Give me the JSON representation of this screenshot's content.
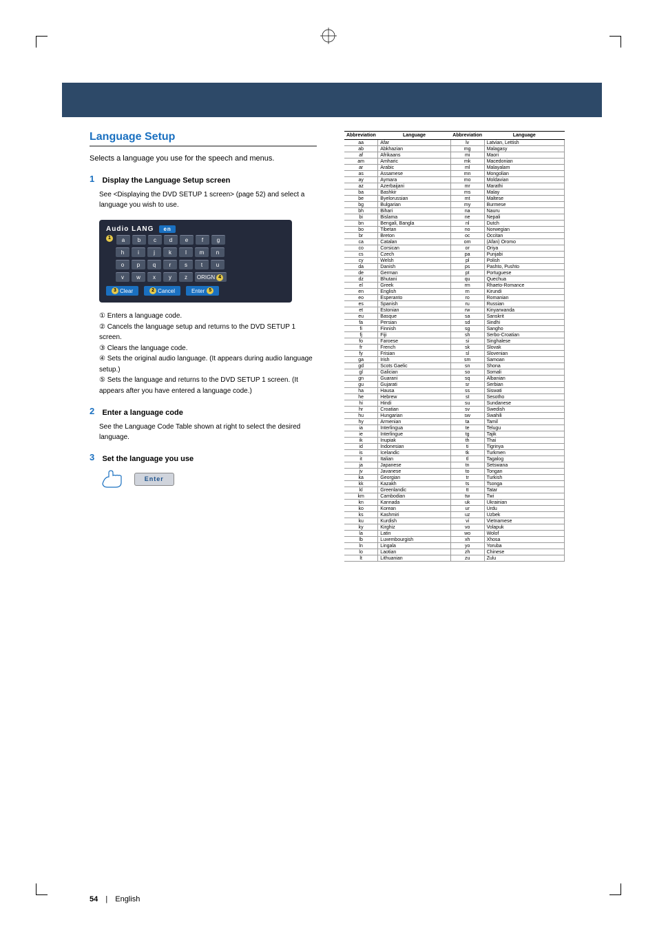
{
  "header": {
    "band": true
  },
  "title": "Language Setup",
  "intro": "Selects a language you use for the speech and menus.",
  "steps": [
    {
      "num": "1",
      "head": "Display the Language Setup screen",
      "body": "See <Displaying the DVD SETUP 1 screen> (page 52) and select a language you wish to use."
    },
    {
      "num": "2",
      "head": "Enter a language code",
      "body": "See the Language Code Table shown at right to select the desired language."
    },
    {
      "num": "3",
      "head": "Set the language you use",
      "body": ""
    }
  ],
  "screen": {
    "title": "Audio  LANG",
    "sub": "en",
    "rows": [
      [
        "a",
        "b",
        "c",
        "d",
        "e",
        "f",
        "g"
      ],
      [
        "h",
        "i",
        "j",
        "k",
        "l",
        "m",
        "n"
      ],
      [
        "o",
        "p",
        "q",
        "r",
        "s",
        "t",
        "u"
      ],
      [
        "v",
        "w",
        "x",
        "y",
        "z",
        "ORIGN"
      ]
    ],
    "badges": {
      "row0": "1",
      "origin": "4"
    },
    "bottom": {
      "clear": "Clear",
      "clear_badge": "3",
      "cancel": "Cancel",
      "cancel_badge": "2",
      "enter": "Enter",
      "enter_badge": "5"
    }
  },
  "listitems": [
    "① Enters a language code.",
    "② Cancels the language setup and returns to the DVD SETUP 1 screen.",
    "③ Clears the language code.",
    "④ Sets the original audio language. (It appears during audio language setup.)",
    "⑤ Sets the language and returns to the DVD SETUP 1 screen. (It appears after you have entered a language code.)"
  ],
  "enter_label": "Enter",
  "table": {
    "headers": [
      "Abbreviation",
      "Language",
      "Abbreviation",
      "Language"
    ],
    "rows": [
      [
        "aa",
        "Afar",
        "lv",
        "Latvian, Lettish"
      ],
      [
        "ab",
        "Abkhazian",
        "mg",
        "Malagasy"
      ],
      [
        "af",
        "Afrikaans",
        "mi",
        "Maori"
      ],
      [
        "am",
        "Amharic",
        "mk",
        "Macedonian"
      ],
      [
        "ar",
        "Arabic",
        "ml",
        "Malayalam"
      ],
      [
        "as",
        "Assamese",
        "mn",
        "Mongolian"
      ],
      [
        "ay",
        "Aymara",
        "mo",
        "Moldavian"
      ],
      [
        "az",
        "Azerbaijani",
        "mr",
        "Marathi"
      ],
      [
        "ba",
        "Bashkir",
        "ms",
        "Malay"
      ],
      [
        "be",
        "Byelorussian",
        "mt",
        "Maltese"
      ],
      [
        "bg",
        "Bulgarian",
        "my",
        "Burmese"
      ],
      [
        "bh",
        "Bihari",
        "na",
        "Nauru"
      ],
      [
        "bi",
        "Bislama",
        "ne",
        "Nepali"
      ],
      [
        "bn",
        "Bengali, Bangla",
        "nl",
        "Dutch"
      ],
      [
        "bo",
        "Tibetan",
        "no",
        "Norwegian"
      ],
      [
        "br",
        "Breton",
        "oc",
        "Occitan"
      ],
      [
        "ca",
        "Catalan",
        "om",
        "(Afan) Oromo"
      ],
      [
        "co",
        "Corsican",
        "or",
        "Oriya"
      ],
      [
        "cs",
        "Czech",
        "pa",
        "Punjabi"
      ],
      [
        "cy",
        "Welsh",
        "pl",
        "Polish"
      ],
      [
        "da",
        "Danish",
        "ps",
        "Pashto, Pushto"
      ],
      [
        "de",
        "German",
        "pt",
        "Portuguese"
      ],
      [
        "dz",
        "Bhutani",
        "qu",
        "Quechua"
      ],
      [
        "el",
        "Greek",
        "rm",
        "Rhaeto-Romance"
      ],
      [
        "en",
        "English",
        "rn",
        "Kirundi"
      ],
      [
        "eo",
        "Esperanto",
        "ro",
        "Romanian"
      ],
      [
        "es",
        "Spanish",
        "ru",
        "Russian"
      ],
      [
        "et",
        "Estonian",
        "rw",
        "Kinyarwanda"
      ],
      [
        "eu",
        "Basque",
        "sa",
        "Sanskrit"
      ],
      [
        "fa",
        "Persian",
        "sd",
        "Sindhi"
      ],
      [
        "fi",
        "Finnish",
        "sg",
        "Sangho"
      ],
      [
        "fj",
        "Fiji",
        "sh",
        "Serbo-Croatian"
      ],
      [
        "fo",
        "Faroese",
        "si",
        "Singhalese"
      ],
      [
        "fr",
        "French",
        "sk",
        "Slovak"
      ],
      [
        "fy",
        "Frisian",
        "sl",
        "Slovenian"
      ],
      [
        "ga",
        "Irish",
        "sm",
        "Samoan"
      ],
      [
        "gd",
        "Scots Gaelic",
        "sn",
        "Shona"
      ],
      [
        "gl",
        "Galician",
        "so",
        "Somali"
      ],
      [
        "gn",
        "Guarani",
        "sq",
        "Albanian"
      ],
      [
        "gu",
        "Gujarati",
        "sr",
        "Serbian"
      ],
      [
        "ha",
        "Hausa",
        "ss",
        "Siswati"
      ],
      [
        "he",
        "Hebrew",
        "st",
        "Sesotho"
      ],
      [
        "hi",
        "Hindi",
        "su",
        "Sundanese"
      ],
      [
        "hr",
        "Croatian",
        "sv",
        "Swedish"
      ],
      [
        "hu",
        "Hungarian",
        "sw",
        "Swahili"
      ],
      [
        "hy",
        "Armenian",
        "ta",
        "Tamil"
      ],
      [
        "ia",
        "Interlingua",
        "te",
        "Telugu"
      ],
      [
        "ie",
        "Interlingue",
        "tg",
        "Tajik"
      ],
      [
        "ik",
        "Inupiak",
        "th",
        "Thai"
      ],
      [
        "id",
        "Indonesian",
        "ti",
        "Tigrinya"
      ],
      [
        "is",
        "Icelandic",
        "tk",
        "Turkmen"
      ],
      [
        "it",
        "Italian",
        "tl",
        "Tagalog"
      ],
      [
        "ja",
        "Japanese",
        "tn",
        "Setswana"
      ],
      [
        "jv",
        "Javanese",
        "to",
        "Tongan"
      ],
      [
        "ka",
        "Georgian",
        "tr",
        "Turkish"
      ],
      [
        "kk",
        "Kazakh",
        "ts",
        "Tsonga"
      ],
      [
        "kl",
        "Greenlandic",
        "tt",
        "Tatar"
      ],
      [
        "km",
        "Cambodian",
        "tw",
        "Twi"
      ],
      [
        "kn",
        "Kannada",
        "uk",
        "Ukrainian"
      ],
      [
        "ko",
        "Korean",
        "ur",
        "Urdu"
      ],
      [
        "ks",
        "Kashmiri",
        "uz",
        "Uzbek"
      ],
      [
        "ku",
        "Kurdish",
        "vi",
        "Vietnamese"
      ],
      [
        "ky",
        "Kirghiz",
        "vo",
        "Volapuk"
      ],
      [
        "la",
        "Latin",
        "wo",
        "Wolof"
      ],
      [
        "lb",
        "Luxembourgish",
        "xh",
        "Xhosa"
      ],
      [
        "ln",
        "Lingala",
        "yo",
        "Yoruba"
      ],
      [
        "lo",
        "Laotian",
        "zh",
        "Chinese"
      ],
      [
        "lt",
        "Lithuanian",
        "zu",
        "Zulu"
      ]
    ]
  },
  "footer": {
    "page": "54",
    "lang": "English"
  }
}
